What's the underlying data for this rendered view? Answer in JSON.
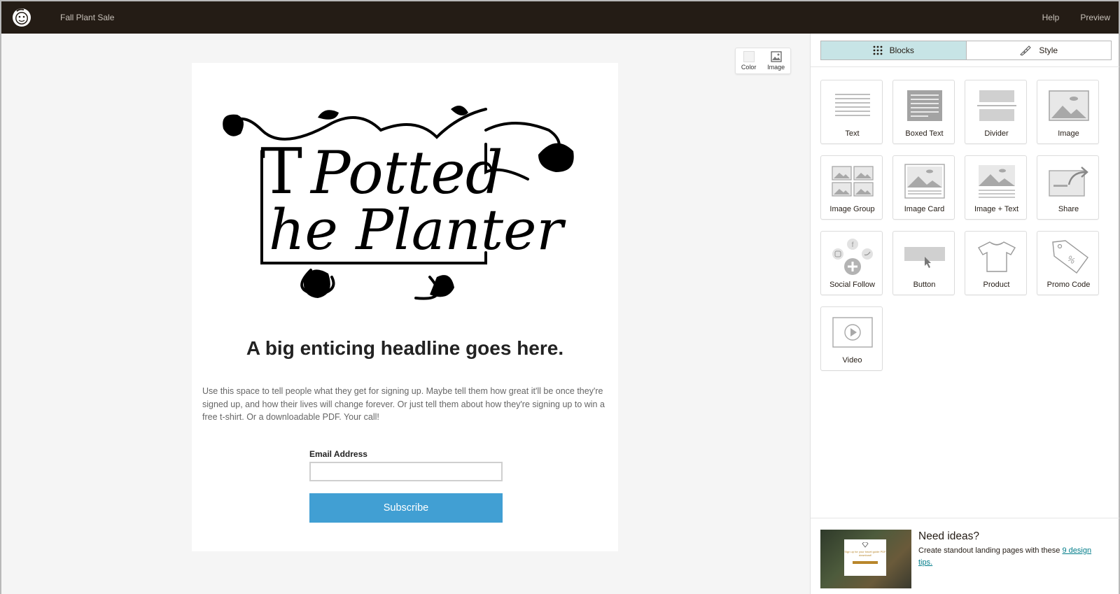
{
  "topbar": {
    "campaign_name": "Fall Plant Sale",
    "help_label": "Help",
    "preview_label": "Preview"
  },
  "background_tools": {
    "color_label": "Color",
    "image_label": "Image"
  },
  "page": {
    "headline": "A big enticing headline goes here.",
    "body_copy": "Use this space to tell people what they get for signing up. Maybe tell them how great it'll be once they're signed up, and how their lives will change forever. Or just tell them about how they're signing up to win a free t-shirt. Or a downloadable PDF. Your call!",
    "email_label": "Email Address",
    "email_value": "",
    "subscribe_label": "Subscribe",
    "brand_logo_text": "The Potted Planter"
  },
  "panel": {
    "tabs": [
      {
        "label": "Blocks",
        "icon": "grid-icon",
        "active": true
      },
      {
        "label": "Style",
        "icon": "paintbrush-icon",
        "active": false
      }
    ],
    "blocks": [
      {
        "label": "Text",
        "icon": "text-lines-icon"
      },
      {
        "label": "Boxed Text",
        "icon": "boxed-text-icon"
      },
      {
        "label": "Divider",
        "icon": "divider-icon"
      },
      {
        "label": "Image",
        "icon": "image-icon"
      },
      {
        "label": "Image Group",
        "icon": "image-group-icon"
      },
      {
        "label": "Image Card",
        "icon": "image-card-icon"
      },
      {
        "label": "Image + Text",
        "icon": "image-text-icon"
      },
      {
        "label": "Share",
        "icon": "share-icon"
      },
      {
        "label": "Social Follow",
        "icon": "social-follow-icon"
      },
      {
        "label": "Button",
        "icon": "button-icon"
      },
      {
        "label": "Product",
        "icon": "tshirt-icon"
      },
      {
        "label": "Promo Code",
        "icon": "tag-icon"
      },
      {
        "label": "Video",
        "icon": "video-icon"
      }
    ],
    "ideas": {
      "title": "Need ideas?",
      "text": "Create standout landing pages with these ",
      "link": "9 design tips.",
      "thumb_caption": "Sign up for your travel guide PDF download!"
    }
  },
  "colors": {
    "topbar": "#241c15",
    "subscribe": "#419fd3",
    "active_tab": "#c7e4e6",
    "link": "#007c89"
  }
}
